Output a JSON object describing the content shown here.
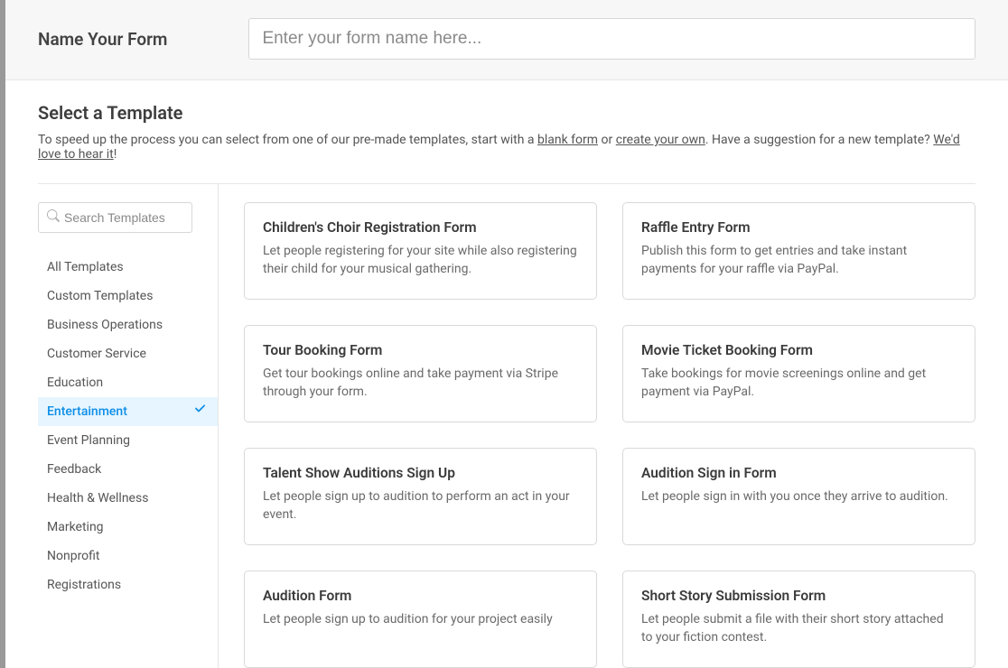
{
  "header": {
    "label": "Name Your Form",
    "placeholder": "Enter your form name here..."
  },
  "section": {
    "title": "Select a Template",
    "desc_pre": "To speed up the process you can select from one of our pre-made templates, start with a ",
    "blank_form": "blank form",
    "or": " or ",
    "create_own": "create your own",
    "suggest": ". Have a suggestion for a new template? ",
    "love_hear": "We'd love to hear it",
    "excl": "!"
  },
  "search": {
    "placeholder": "Search Templates"
  },
  "categories": [
    {
      "label": "All Templates",
      "active": false
    },
    {
      "label": "Custom Templates",
      "active": false
    },
    {
      "label": "Business Operations",
      "active": false
    },
    {
      "label": "Customer Service",
      "active": false
    },
    {
      "label": "Education",
      "active": false
    },
    {
      "label": "Entertainment",
      "active": true
    },
    {
      "label": "Event Planning",
      "active": false
    },
    {
      "label": "Feedback",
      "active": false
    },
    {
      "label": "Health & Wellness",
      "active": false
    },
    {
      "label": "Marketing",
      "active": false
    },
    {
      "label": "Nonprofit",
      "active": false
    },
    {
      "label": "Registrations",
      "active": false
    }
  ],
  "templates": [
    {
      "title": "Children's Choir Registration Form",
      "desc": "Let people registering for your site while also registering their child for your musical gathering."
    },
    {
      "title": "Raffle Entry Form",
      "desc": "Publish this form to get entries and take instant payments for your raffle via PayPal."
    },
    {
      "title": "Tour Booking Form",
      "desc": "Get tour bookings online and take payment via Stripe through your form."
    },
    {
      "title": "Movie Ticket Booking Form",
      "desc": "Take bookings for movie screenings online and get payment via PayPal."
    },
    {
      "title": "Talent Show Auditions Sign Up",
      "desc": "Let people sign up to audition to perform an act in your event."
    },
    {
      "title": "Audition Sign in Form",
      "desc": "Let people sign in with you once they arrive to audition."
    },
    {
      "title": "Audition Form",
      "desc": "Let people sign up to audition for your project easily"
    },
    {
      "title": "Short Story Submission Form",
      "desc": "Let people submit a file with their short story attached to your fiction contest."
    }
  ]
}
